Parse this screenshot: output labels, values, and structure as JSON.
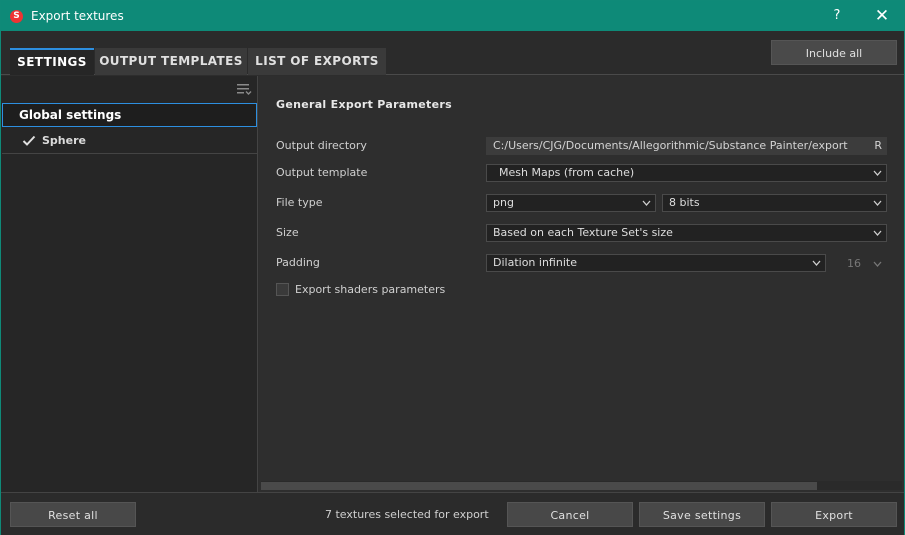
{
  "window": {
    "title": "Export textures",
    "help_label": "?",
    "close_label": "✕",
    "app_icon_letter": "S"
  },
  "tabs": [
    {
      "label": "SETTINGS",
      "active": true
    },
    {
      "label": "OUTPUT TEMPLATES",
      "active": false
    },
    {
      "label": "LIST OF EXPORTS",
      "active": false
    }
  ],
  "toolbar": {
    "include_all_label": "Include all"
  },
  "texture_sets": {
    "global_label": "Global settings",
    "items": [
      {
        "label": "Sphere",
        "checked": true
      }
    ]
  },
  "parameters": {
    "section_title": "General Export Parameters",
    "output_directory": {
      "label": "Output directory",
      "value": "C:/Users/CJG/Documents/Allegorithmic/Substance Painter/export",
      "trailing": "R"
    },
    "output_template": {
      "label": "Output template",
      "value": "Mesh Maps (from cache)"
    },
    "file_type": {
      "label": "File type",
      "format": "png",
      "bit_depth": "8 bits"
    },
    "size": {
      "label": "Size",
      "value": "Based on each Texture Set's size"
    },
    "padding": {
      "label": "Padding",
      "value": "Dilation infinite",
      "distance": "16"
    },
    "export_shaders": {
      "label": "Export shaders parameters",
      "checked": false
    }
  },
  "footer": {
    "reset_all_label": "Reset all",
    "status_text": "7 textures selected for export",
    "cancel_label": "Cancel",
    "save_settings_label": "Save settings",
    "export_label": "Export"
  },
  "colors": {
    "titlebar": "#0e8a78",
    "accent": "#2d8fe0",
    "panel_bg": "#2e2e2e"
  },
  "icons": {
    "app": "substance-painter-icon",
    "list_options": "list-options-icon",
    "check": "check-icon",
    "dropdown": "chevron-down-icon"
  }
}
